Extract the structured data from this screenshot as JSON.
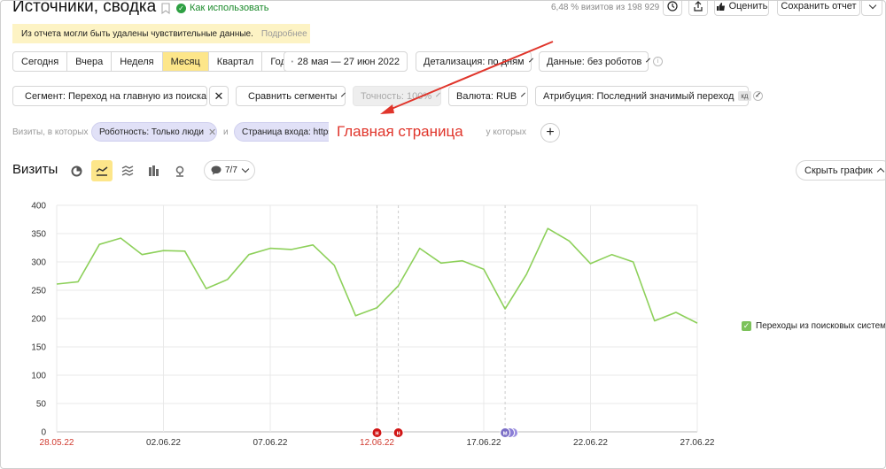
{
  "header": {
    "title": "Источники, сводка",
    "howto_label": "Как использовать",
    "visits_share": "6,48 % визитов из 198 929",
    "rate_label": "Оценить",
    "save_label": "Сохранить отчет"
  },
  "notice": {
    "text": "Из отчета могли быть удалены чувствительные данные.",
    "more_label": "Подробнее"
  },
  "periods": {
    "items": [
      "Сегодня",
      "Вчера",
      "Неделя",
      "Месяц",
      "Квартал",
      "Год"
    ],
    "active": "Месяц"
  },
  "date_range": "28 мая — 27 июн 2022",
  "detail_label": "Детализация: по дням",
  "data_label": "Данные: без роботов",
  "segment_label": "Сегмент: Переход на главную из поиска",
  "compare_label": "Сравнить сегменты",
  "accuracy_label": "Точность: 100%",
  "currency_label": "Валюта: RUB",
  "attribution_label": "Атрибуция: Последний значимый переход",
  "attribution_badge": "кд",
  "filters": {
    "prefix": "Визиты, в которых",
    "chip1": "Роботность: Только люди",
    "and_label": "и",
    "chip2": "Страница входа: https",
    "suffix": ", у которых"
  },
  "annotation": {
    "text": "Главная страница",
    "color": "#e0352b"
  },
  "chart_toolbar": {
    "title": "Визиты",
    "comments_label": "7/7",
    "hide_graph_label": "Скрыть график",
    "icons": [
      "pie-chart-icon",
      "line-chart-icon",
      "stacked-area-icon",
      "bar-chart-icon",
      "map-marker-icon"
    ]
  },
  "legend_label": "Переходы из поисковых систем",
  "colors": {
    "series": "#8dd05a",
    "active": "#fde68a",
    "chip": "#e1e1f7",
    "marker_red": "#d01515",
    "marker_purple": "#7b6ec6"
  },
  "chart_data": {
    "type": "line",
    "series": [
      {
        "name": "Переходы из поисковых систем",
        "values": [
          261,
          265,
          331,
          342,
          313,
          320,
          319,
          253,
          269,
          313,
          324,
          322,
          330,
          294,
          205,
          219,
          258,
          324,
          298,
          302,
          287,
          217,
          278,
          359,
          337,
          297,
          313,
          300,
          196,
          211,
          192
        ]
      }
    ],
    "x_ticks": [
      "28.05.22",
      "02.06.22",
      "07.06.22",
      "12.06.22",
      "17.06.22",
      "22.06.22",
      "27.06.22"
    ],
    "x_tick_indices": [
      0,
      5,
      10,
      15,
      20,
      25,
      30
    ],
    "weekend_tick_indices": [
      0,
      15
    ],
    "ylim": [
      0,
      400
    ],
    "y_ticks": [
      0,
      50,
      100,
      150,
      200,
      250,
      300,
      350,
      400
    ],
    "grid": true,
    "legend_position": "right",
    "markers": [
      {
        "index": 15,
        "label": "н",
        "color": "#d01515"
      },
      {
        "index": 16,
        "label": "н",
        "color": "#d01515"
      },
      {
        "index": 21,
        "label": "м",
        "color": "#7b6ec6"
      }
    ]
  }
}
